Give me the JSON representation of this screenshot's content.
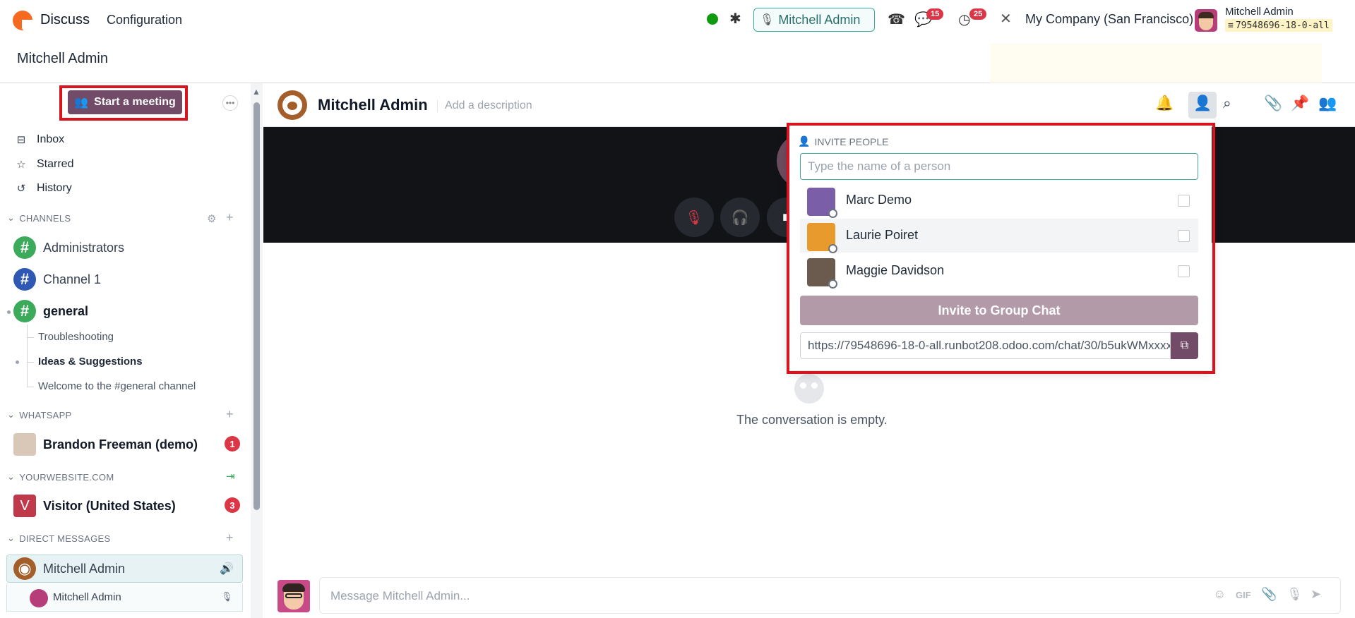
{
  "navbar": {
    "app_name": "Discuss",
    "menu": "Configuration",
    "call_chip_label": "Mitchell Admin",
    "messages_badge": "15",
    "activities_badge": "25",
    "company": "My Company (San Francisco)",
    "user_name": "Mitchell Admin",
    "db_name": "79548696-18-0-all"
  },
  "breadcrumb": "Mitchell Admin",
  "sidebar": {
    "start_meeting": "Start a meeting",
    "nav": [
      {
        "label": "Inbox",
        "icon": "inbox-icon"
      },
      {
        "label": "Starred",
        "icon": "star-icon"
      },
      {
        "label": "History",
        "icon": "history-icon"
      }
    ],
    "sections": {
      "channels": "CHANNELS",
      "whatsapp": "WHATSAPP",
      "website": "YOURWEBSITE.COM",
      "direct": "DIRECT MESSAGES"
    },
    "channels": [
      {
        "name": "Administrators",
        "color": "#3bab5b"
      },
      {
        "name": "Channel 1",
        "color": "#2f57b4"
      },
      {
        "name": "general",
        "color": "#3bab5b"
      }
    ],
    "threads": [
      "Troubleshooting",
      "Ideas & Suggestions",
      "Welcome to the #general channel"
    ],
    "whatsapp_contact": {
      "name": "Brandon Freeman (demo)",
      "badge": "1"
    },
    "website_visitor": {
      "name": "Visitor (United States)",
      "badge": "3",
      "initial": "V"
    },
    "dm_active": "Mitchell Admin",
    "dm_participant": "Mitchell Admin"
  },
  "thread": {
    "title": "Mitchell Admin",
    "description_placeholder": "Add a description",
    "empty_text": "The conversation is empty.",
    "composer_placeholder": "Message Mitchell Admin..."
  },
  "invite": {
    "title": "INVITE PEOPLE",
    "search_placeholder": "Type the name of a person",
    "people": [
      {
        "name": "Marc Demo",
        "checked": false
      },
      {
        "name": "Laurie Poiret",
        "checked": false
      },
      {
        "name": "Maggie Davidson",
        "checked": false
      }
    ],
    "button": "Invite to Group Chat",
    "link": "https://79548696-18-0-all.runbot208.odoo.com/chat/30/b5ukWMxxxx"
  },
  "colors": {
    "brand": "#714b67",
    "highlight_box": "#d7141f",
    "accent_teal": "#3ea7a2",
    "badge_red": "#dc3545"
  }
}
